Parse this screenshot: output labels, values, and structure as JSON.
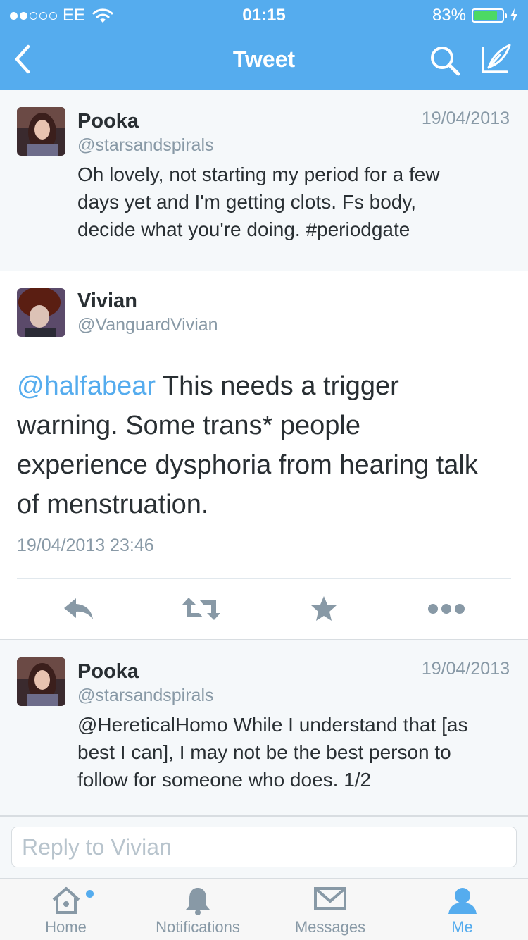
{
  "status_bar": {
    "carrier": "EE",
    "time": "01:15",
    "battery_percent": "83%",
    "battery_level": 0.83,
    "signal_bars_filled": 2,
    "signal_bars_total": 5
  },
  "nav": {
    "title": "Tweet",
    "back_icon": "chevron-left-icon",
    "search_icon": "search-icon",
    "compose_icon": "compose-quill-icon"
  },
  "tweet_1": {
    "name": "Pooka",
    "handle": "@starsandspirals",
    "date": "19/04/2013",
    "text_lines": [
      "Oh lovely, not starting my period for a few",
      "days yet and I'm getting clots. Fs body,",
      "decide what you're doing. #periodgate"
    ]
  },
  "main_tweet": {
    "name": "Vivian",
    "handle": "@VanguardVivian",
    "mention": "@halfabear",
    "lines": [
      " This needs a trigger",
      "warning. Some trans* people",
      "experience dysphoria from hearing talk",
      "of menstruation."
    ],
    "timestamp": "19/04/2013 23:46",
    "actions": [
      "reply-icon",
      "retweet-icon",
      "favorite-star-icon",
      "more-dots-icon"
    ]
  },
  "tweet_3": {
    "name": "Pooka",
    "handle": "@starsandspirals",
    "date": "19/04/2013",
    "text_lines": [
      "@HereticalHomo While I understand that [as",
      "best I can], I may not be the best person to",
      "follow for someone who does. 1/2"
    ]
  },
  "reply": {
    "placeholder": "Reply to Vivian"
  },
  "tabs": [
    {
      "label": "Home",
      "icon": "home-icon",
      "active": false
    },
    {
      "label": "Notifications",
      "icon": "bell-icon",
      "active": false
    },
    {
      "label": "Messages",
      "icon": "envelope-icon",
      "active": false
    },
    {
      "label": "Me",
      "icon": "person-icon",
      "active": true
    }
  ],
  "colors": {
    "brand": "#55acee",
    "text": "#292f33",
    "muted": "#8899a6",
    "battery_fill": "#4cd964"
  }
}
